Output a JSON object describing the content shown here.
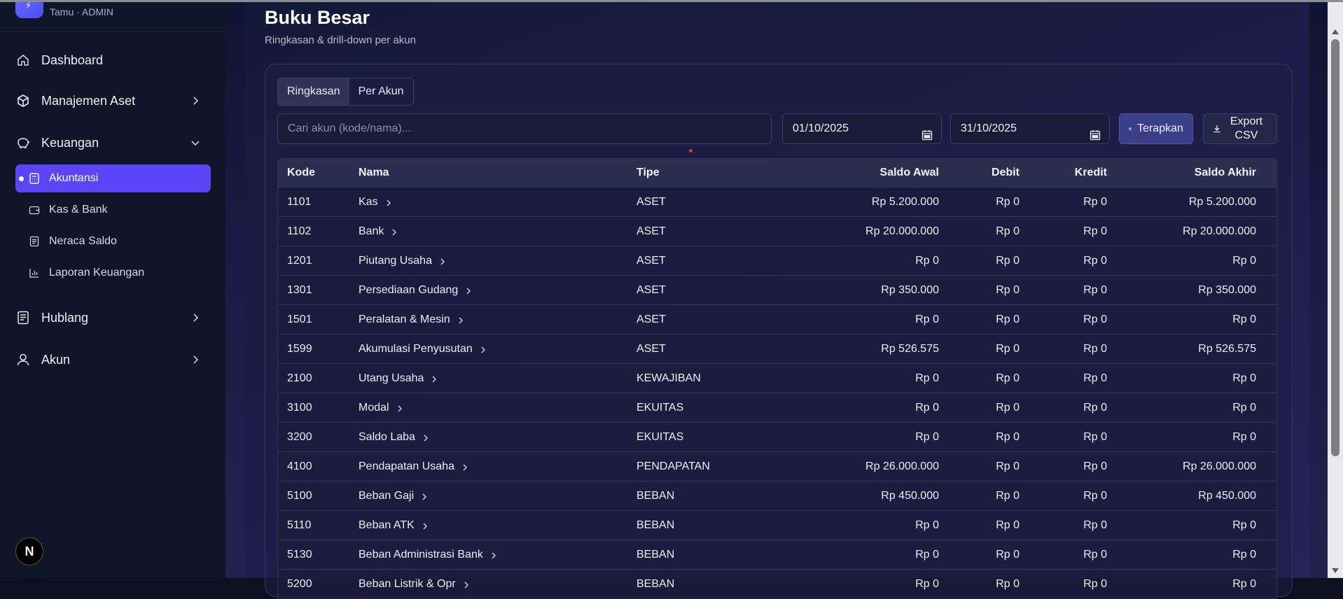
{
  "brand": {
    "subtitle": "Tamu · ADMIN",
    "logo_icon": "bolt-icon"
  },
  "sidebar": {
    "items": [
      {
        "label": "Dashboard",
        "icon": "home-icon"
      },
      {
        "label": "Manajemen Aset",
        "icon": "box-icon"
      },
      {
        "label": "Keuangan",
        "icon": "piggy-bank-icon"
      },
      {
        "label": "Hublang",
        "icon": "document-icon"
      },
      {
        "label": "Akun",
        "icon": "user-icon"
      }
    ],
    "sub_items": [
      {
        "label": "Akuntansi",
        "icon": "calculator-icon",
        "active": true
      },
      {
        "label": "Kas & Bank",
        "icon": "wallet-icon"
      },
      {
        "label": "Neraca Saldo",
        "icon": "file-icon"
      },
      {
        "label": "Laporan Keuangan",
        "icon": "bar-chart-icon"
      }
    ],
    "badge": "N",
    "active_color": "#5a44f5"
  },
  "page": {
    "title": "Buku Besar",
    "subtitle": "Ringkasan & drill-down per akun"
  },
  "tabs": [
    {
      "label": "Ringkasan",
      "active": true
    },
    {
      "label": "Per Akun"
    }
  ],
  "filters": {
    "search_placeholder": "Cari akun (kode/nama)...",
    "date_from": "01/10/2025",
    "date_to": "31/10/2025",
    "apply_label": "Terapkan",
    "export_label": "Export CSV"
  },
  "table": {
    "headers": {
      "kode": "Kode",
      "nama": "Nama",
      "tipe": "Tipe",
      "awal": "Saldo Awal",
      "debit": "Debit",
      "kredit": "Kredit",
      "akhir": "Saldo Akhir"
    },
    "rows": [
      {
        "kode": "1101",
        "nama": "Kas",
        "tipe": "ASET",
        "awal": "Rp 5.200.000",
        "debit": "Rp 0",
        "kredit": "Rp 0",
        "akhir": "Rp 5.200.000"
      },
      {
        "kode": "1102",
        "nama": "Bank",
        "tipe": "ASET",
        "awal": "Rp 20.000.000",
        "debit": "Rp 0",
        "kredit": "Rp 0",
        "akhir": "Rp 20.000.000"
      },
      {
        "kode": "1201",
        "nama": "Piutang Usaha",
        "tipe": "ASET",
        "awal": "Rp 0",
        "debit": "Rp 0",
        "kredit": "Rp 0",
        "akhir": "Rp 0"
      },
      {
        "kode": "1301",
        "nama": "Persediaan Gudang",
        "tipe": "ASET",
        "awal": "Rp 350.000",
        "debit": "Rp 0",
        "kredit": "Rp 0",
        "akhir": "Rp 350.000"
      },
      {
        "kode": "1501",
        "nama": "Peralatan & Mesin",
        "tipe": "ASET",
        "awal": "Rp 0",
        "debit": "Rp 0",
        "kredit": "Rp 0",
        "akhir": "Rp 0"
      },
      {
        "kode": "1599",
        "nama": "Akumulasi Penyusutan",
        "tipe": "ASET",
        "awal": "Rp 526.575",
        "debit": "Rp 0",
        "kredit": "Rp 0",
        "akhir": "Rp 526.575"
      },
      {
        "kode": "2100",
        "nama": "Utang Usaha",
        "tipe": "KEWAJIBAN",
        "awal": "Rp 0",
        "debit": "Rp 0",
        "kredit": "Rp 0",
        "akhir": "Rp 0"
      },
      {
        "kode": "3100",
        "nama": "Modal",
        "tipe": "EKUITAS",
        "awal": "Rp 0",
        "debit": "Rp 0",
        "kredit": "Rp 0",
        "akhir": "Rp 0"
      },
      {
        "kode": "3200",
        "nama": "Saldo Laba",
        "tipe": "EKUITAS",
        "awal": "Rp 0",
        "debit": "Rp 0",
        "kredit": "Rp 0",
        "akhir": "Rp 0"
      },
      {
        "kode": "4100",
        "nama": "Pendapatan Usaha",
        "tipe": "PENDAPATAN",
        "awal": "Rp 26.000.000",
        "debit": "Rp 0",
        "kredit": "Rp 0",
        "akhir": "Rp 26.000.000"
      },
      {
        "kode": "5100",
        "nama": "Beban Gaji",
        "tipe": "BEBAN",
        "awal": "Rp 450.000",
        "debit": "Rp 0",
        "kredit": "Rp 0",
        "akhir": "Rp 450.000"
      },
      {
        "kode": "5110",
        "nama": "Beban ATK",
        "tipe": "BEBAN",
        "awal": "Rp 0",
        "debit": "Rp 0",
        "kredit": "Rp 0",
        "akhir": "Rp 0"
      },
      {
        "kode": "5130",
        "nama": "Beban Administrasi Bank",
        "tipe": "BEBAN",
        "awal": "Rp 0",
        "debit": "Rp 0",
        "kredit": "Rp 0",
        "akhir": "Rp 0"
      },
      {
        "kode": "5200",
        "nama": "Beban Listrik & Opr",
        "tipe": "BEBAN",
        "awal": "Rp 0",
        "debit": "Rp 0",
        "kredit": "Rp 0",
        "akhir": "Rp 0"
      }
    ]
  }
}
